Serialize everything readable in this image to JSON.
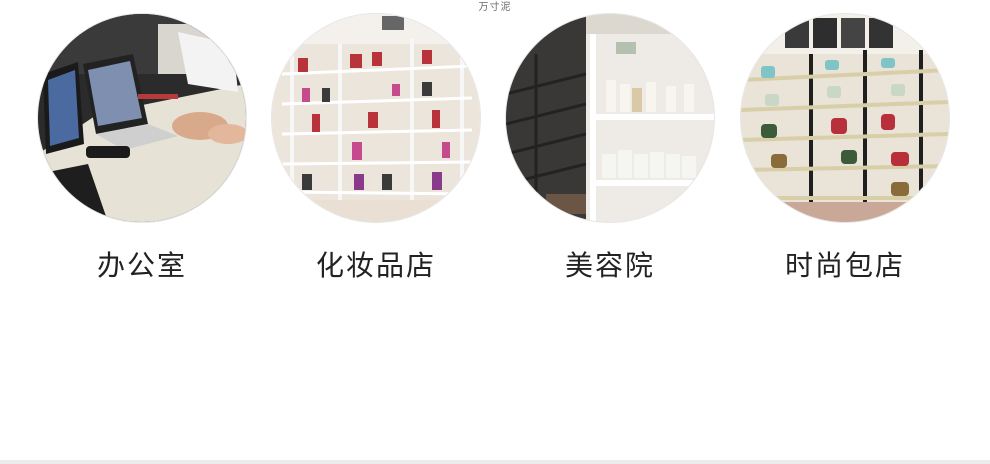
{
  "header": {
    "caption": "万寸泥"
  },
  "items": [
    {
      "label": "办公室",
      "image": "office-photo"
    },
    {
      "label": "化妆品店",
      "image": "cosmetics-store-shelves-photo"
    },
    {
      "label": "美容院",
      "image": "beauty-salon-shelves-photo"
    },
    {
      "label": "时尚包店",
      "image": "handbag-store-shelves-photo"
    }
  ]
}
